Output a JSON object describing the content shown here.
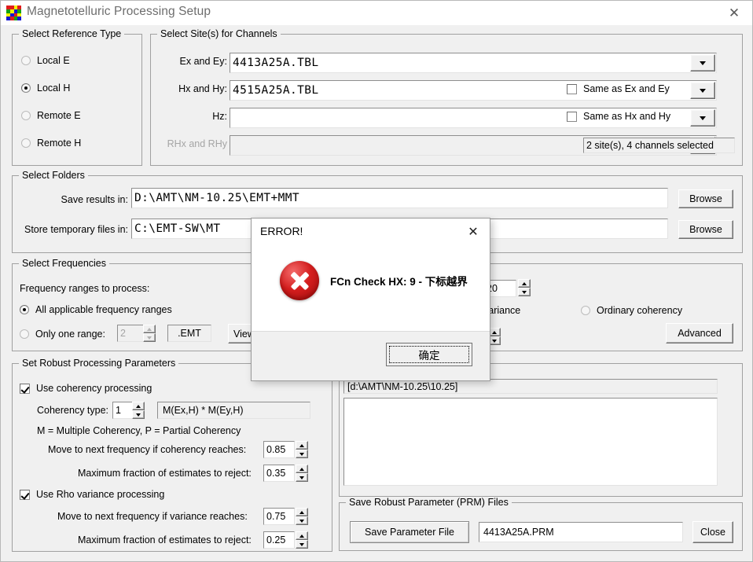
{
  "window": {
    "title": "Magnetotelluric Processing Setup",
    "icon": "ssmt2000-app-icon",
    "close_label": "✕"
  },
  "reference_type": {
    "group_title": "Select Reference Type",
    "options": [
      {
        "label": "Local E",
        "selected": false
      },
      {
        "label": "Local H",
        "selected": true
      },
      {
        "label": "Remote E",
        "selected": false
      },
      {
        "label": "Remote H",
        "selected": false
      }
    ]
  },
  "sites": {
    "group_title": "Select Site(s) for Channels",
    "rows": [
      {
        "label": "Ex and Ey:",
        "value": "4413A25A.TBL",
        "disabled": false
      },
      {
        "label": "Hx and Hy:",
        "value": "4515A25A.TBL",
        "disabled": false
      },
      {
        "label": "Hz:",
        "value": "",
        "disabled": false
      },
      {
        "label": "RHx and RHy",
        "value": "",
        "disabled": true
      }
    ],
    "checkboxes": [
      {
        "label": "Same as Ex and Ey",
        "checked": false
      },
      {
        "label": "Same as Hx and Hy",
        "checked": false
      }
    ],
    "status": "2 site(s), 4 channels selected"
  },
  "folders": {
    "group_title": "Select Folders",
    "save_label": "Save results in:",
    "save_value": "D:\\AMT\\NM-10.25\\EMT+MMT",
    "temp_label": "Store temporary files in:",
    "temp_value": "C:\\EMT-SW\\MT",
    "browse_label": "Browse"
  },
  "frequencies": {
    "group_title": "Select Frequencies",
    "prompt": "Frequency ranges to process:",
    "all_ranges_label": "All applicable frequency ranges",
    "all_ranges_selected": true,
    "one_range_label": "Only one range:",
    "one_range_selected": false,
    "one_range_value": "2",
    "ext_value": ".EMT",
    "view_label": "View",
    "count_value": "20",
    "variance_label": "variance",
    "ordinary_coherency_label": "Ordinary coherency",
    "ordinary_coherency_selected": false,
    "advanced_label": "Advanced"
  },
  "robust": {
    "group_title": "Set Robust Processing Parameters",
    "use_coherency_label": "Use coherency processing",
    "use_coherency_checked": true,
    "coherency_type_label": "Coherency type:",
    "coherency_type_value": "1",
    "coherency_formula": "M(Ex,H) * M(Ey,H)",
    "legend": "M = Multiple Coherency, P = Partial Coherency",
    "coh_move_label": "Move to next frequency if coherency reaches:",
    "coh_move_value": "0.85",
    "coh_reject_label": "Maximum fraction of estimates to reject:",
    "coh_reject_value": "0.35",
    "use_rho_label": "Use Rho variance processing",
    "use_rho_checked": true,
    "rho_move_label": "Move to next frequency if variance reaches:",
    "rho_move_value": "0.75",
    "rho_reject_label": "Maximum fraction of estimates to reject:",
    "rho_reject_value": "0.25"
  },
  "filelist": {
    "path": "[d:\\AMT\\NM-10.25\\10.25]",
    "items": []
  },
  "prm": {
    "group_title": "Save Robust Parameter (PRM) Files",
    "save_button_label": "Save Parameter File",
    "filename": "4413A25A.PRM",
    "close_label": "Close"
  },
  "error_dialog": {
    "title": "ERROR!",
    "close_label": "✕",
    "icon": "error-circle-x-icon",
    "message": "FCn Check HX: 9 - 下标越界",
    "ok_label": "确定"
  },
  "colors": {
    "face": "#f0f0f0",
    "error_red": "#d41e1e",
    "disabled_text": "#a5a5a5"
  }
}
